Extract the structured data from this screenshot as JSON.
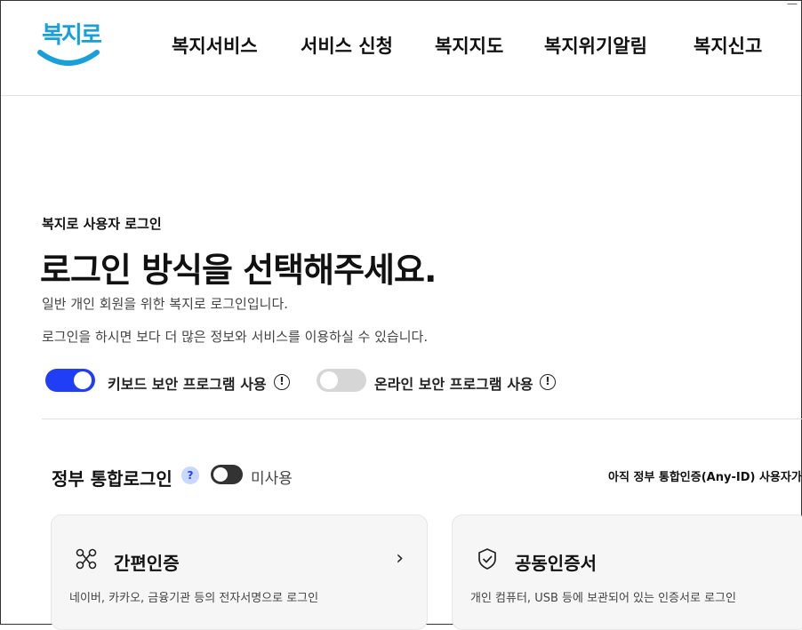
{
  "header": {
    "logo_text": "복지로",
    "corner_mark": "—",
    "nav": [
      {
        "label": "복지서비스"
      },
      {
        "label": "서비스 신청"
      },
      {
        "label": "복지지도"
      },
      {
        "label": "복지위기알림"
      },
      {
        "label": "복지신고"
      }
    ]
  },
  "main": {
    "kicker": "복지로 사용자 로그인",
    "title": "로그인 방식을 선택해주세요.",
    "desc1": "일반 개인 회원을 위한 복지로 로그인입니다.",
    "desc2": "로그인을 하시면 보다 더 많은 정보와 서비스를 이용하실 수 있습니다.",
    "options": [
      {
        "label": "키보드 보안 프로그램 사용",
        "state": "on",
        "info": "!"
      },
      {
        "label": "온라인 보안 프로그램 사용",
        "state": "off",
        "info": "!"
      }
    ]
  },
  "gov_login": {
    "title": "정부 통합로그인",
    "help": "?",
    "toggle_label": "미사용",
    "notice": "아직 정부 통합인증(Any-ID) 사용자가"
  },
  "cards": [
    {
      "title": "간편인증",
      "desc": "네이버, 카카오, 금융기관 등의 전자서명으로 로그인",
      "icon": "link-nodes-icon",
      "chevron": "›"
    },
    {
      "title": "공동인증서",
      "desc": "개인 컴퓨터, USB 등에 보관되어 있는 인증서로 로그인",
      "icon": "shield-check-icon",
      "chevron": "›"
    }
  ],
  "colors": {
    "accent": "#1f3ef5",
    "logo": "#1aa0d8"
  }
}
